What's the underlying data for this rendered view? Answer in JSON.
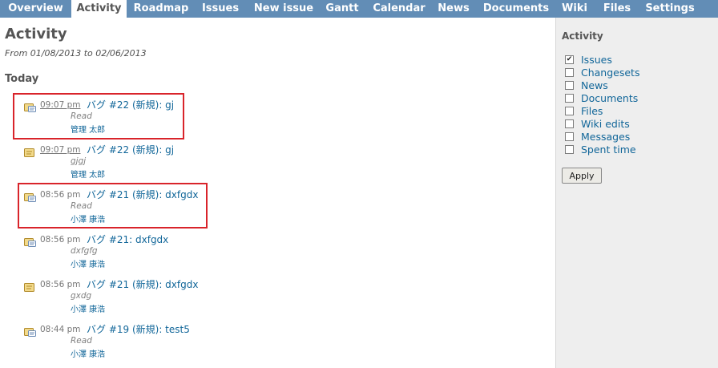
{
  "nav": {
    "tabs": [
      {
        "label": "Overview"
      },
      {
        "label": "Activity",
        "active": true
      },
      {
        "label": "Roadmap"
      },
      {
        "label": "Issues"
      },
      {
        "label": "New issue"
      },
      {
        "label": "Gantt"
      },
      {
        "label": "Calendar"
      },
      {
        "label": "News"
      },
      {
        "label": "Documents"
      },
      {
        "label": "Wiki"
      },
      {
        "label": "Files"
      },
      {
        "label": "Settings"
      }
    ]
  },
  "main": {
    "title": "Activity",
    "date_range": "From 01/08/2013 to 02/06/2013",
    "day_heading": "Today",
    "events": [
      {
        "time": "09:07 pm",
        "title": "バグ #22 (新規): gj",
        "desc": "Read",
        "author": "管理 太郎",
        "icon": "issue-note-icon",
        "highlighted": true
      },
      {
        "time": "09:07 pm",
        "title": "バグ #22 (新規): gj",
        "desc": "gjgj",
        "author": "管理 太郎",
        "icon": "issue-edit-icon",
        "highlighted": false
      },
      {
        "time": "08:56 pm",
        "title": "バグ #21 (新規): dxfgdx",
        "desc": "Read",
        "author": "小澤 康浩",
        "icon": "issue-note-icon",
        "highlighted": true
      },
      {
        "time": "08:56 pm",
        "title": "バグ #21: dxfgdx",
        "desc": "dxfgfg",
        "author": "小澤 康浩",
        "icon": "issue-note-icon",
        "highlighted": false
      },
      {
        "time": "08:56 pm",
        "title": "バグ #21 (新規): dxfgdx",
        "desc": "gxdg",
        "author": "小澤 康浩",
        "icon": "issue-edit-icon",
        "highlighted": false
      },
      {
        "time": "08:44 pm",
        "title": "バグ #19 (新規): test5",
        "desc": "Read",
        "author": "小澤 康浩",
        "icon": "issue-note-icon",
        "highlighted": false
      }
    ]
  },
  "sidebar": {
    "title": "Activity",
    "filters": [
      {
        "label": "Issues",
        "checked": true
      },
      {
        "label": "Changesets",
        "checked": false
      },
      {
        "label": "News",
        "checked": false
      },
      {
        "label": "Documents",
        "checked": false
      },
      {
        "label": "Files",
        "checked": false
      },
      {
        "label": "Wiki edits",
        "checked": false
      },
      {
        "label": "Messages",
        "checked": false
      },
      {
        "label": "Spent time",
        "checked": false
      }
    ],
    "apply_label": "Apply",
    "check_glyph": "✔"
  }
}
